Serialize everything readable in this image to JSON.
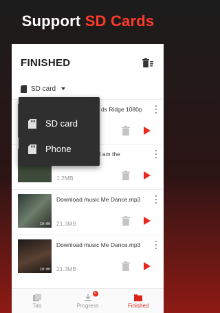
{
  "headline": {
    "prefix": "Support",
    "accent": "SD Cards"
  },
  "header": {
    "title": "FINISHED"
  },
  "storage_selector": {
    "value": "SD card"
  },
  "dropdown": {
    "options": [
      "SD card",
      "Phone"
    ]
  },
  "downloads": [
    {
      "title": "ds Ridge 1080p",
      "size": "",
      "duration": ""
    },
    {
      "title": "e I am the",
      "size": "1.2MB",
      "duration": ""
    },
    {
      "title": "Download music Me Dance.mp3",
      "size": "21.3MB",
      "duration": "10:00"
    },
    {
      "title": "Download music Me Dance.mp3",
      "size": "21.3MB",
      "duration": "10:00"
    }
  ],
  "bottom_nav": {
    "tabs": [
      {
        "label": "Tab",
        "icon": "tab-icon"
      },
      {
        "label": "Progress",
        "icon": "download-progress-icon",
        "badge": "0"
      },
      {
        "label": "Finished",
        "icon": "folder-icon"
      }
    ]
  },
  "colors": {
    "accent": "#e8281c",
    "headline_accent": "#ff3a2a",
    "dropdown_bg": "#2f2f2f"
  }
}
